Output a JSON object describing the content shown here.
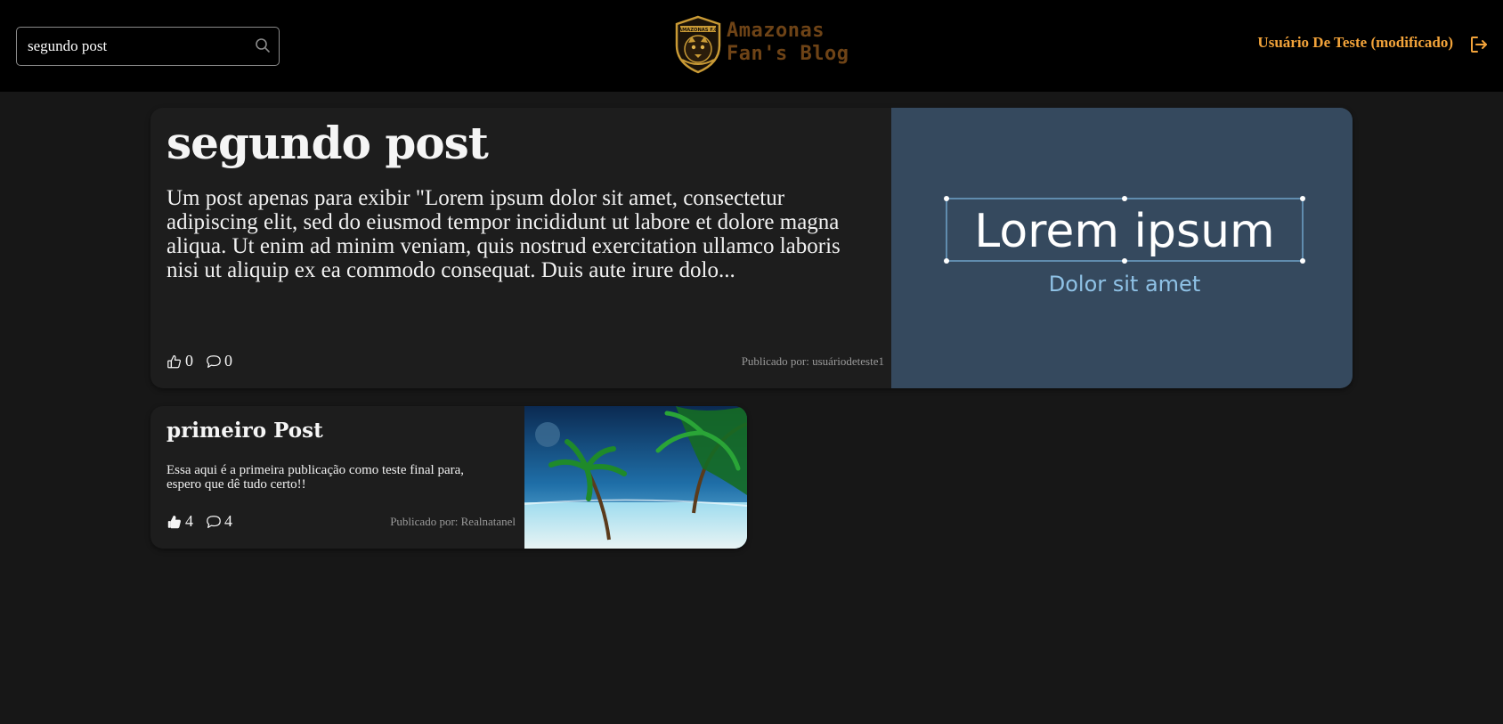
{
  "header": {
    "search": {
      "value": "segundo post",
      "icon": "search-icon"
    },
    "logo": {
      "line1": "Amazonas",
      "line2": "Fan's Blog",
      "badge_text": "AMAZONAS F.C",
      "icon": "jaguar-badge-icon"
    },
    "user_name": "Usuário De Teste (modificado)",
    "logout_icon": "logout-icon",
    "accent_color": "#f2a33a"
  },
  "posts": [
    {
      "title": "segundo post",
      "excerpt": "Um post apenas para exibir \"Lorem ipsum dolor sit amet, consectetur adipiscing elit, sed do eiusmod tempor incididunt ut labore et dolore magna aliqua. Ut enim ad minim veniam, quis nostrud exercitation ullamco laboris nisi ut aliquip ex ea commodo consequat. Duis aute irure dolo...",
      "likes": "0",
      "comments": "0",
      "author": "Publicado por: usuáriodeteste1",
      "image": {
        "headline": "Lorem ipsum",
        "subline": "Dolor sit amet",
        "background": "#35495e"
      }
    },
    {
      "title": "primeiro Post",
      "excerpt": "Essa aqui é a primeira publicação como teste final para, espero que dê tudo certo!!",
      "likes": "4",
      "comments": "4",
      "liked": true,
      "author": "Publicado por: Realnatanel",
      "image": {
        "subject": "tropical beach with palm trees"
      }
    }
  ]
}
